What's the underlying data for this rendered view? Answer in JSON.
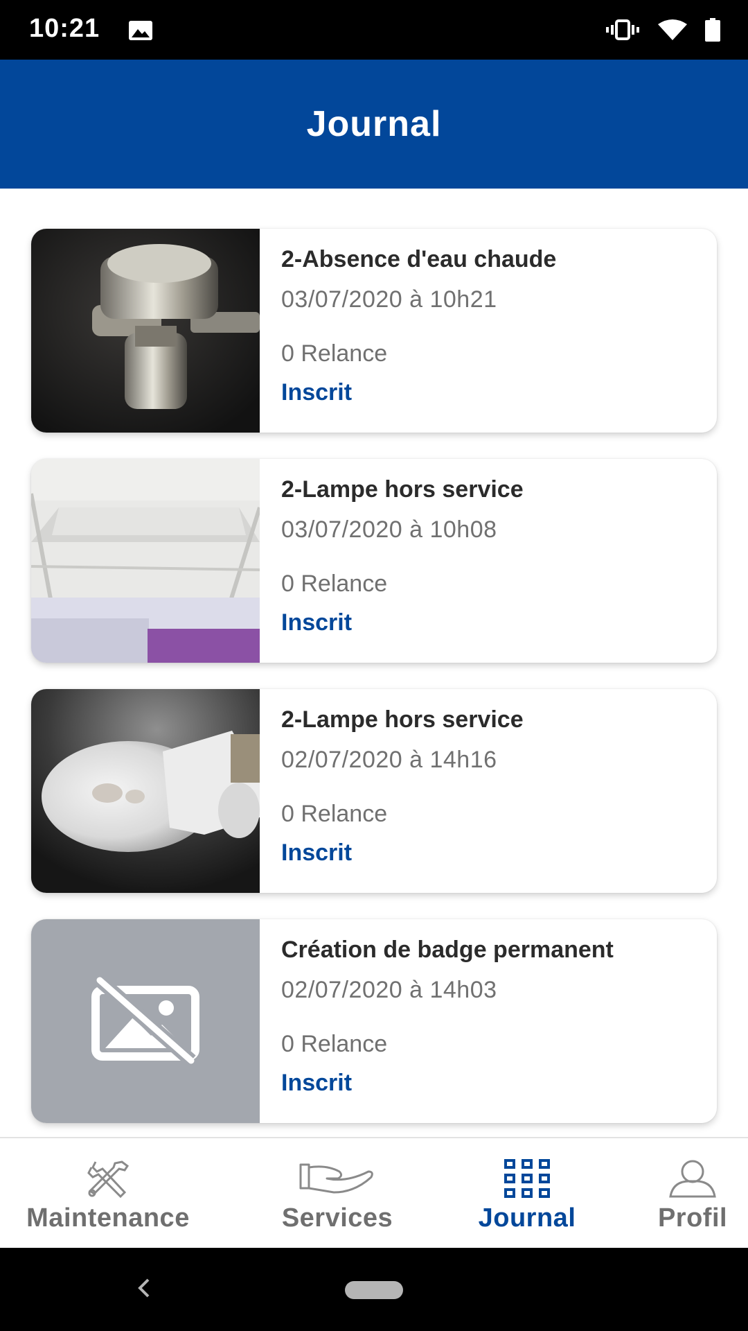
{
  "status_bar": {
    "time": "10:21",
    "icons": [
      "image-icon",
      "vibrate-icon",
      "wifi-icon",
      "battery-icon"
    ]
  },
  "header": {
    "title": "Journal",
    "background": "#02479a"
  },
  "cards": [
    {
      "title": "2-Absence d'eau chaude",
      "date": "03/07/2020 à 10h21",
      "relance": "0 Relance",
      "status": "Inscrit",
      "image": "faucet-photo"
    },
    {
      "title": "2-Lampe hors service",
      "date": "03/07/2020 à 10h08",
      "relance": "0 Relance",
      "status": "Inscrit",
      "image": "ceiling-photo"
    },
    {
      "title": "2-Lampe hors service",
      "date": "02/07/2020 à 14h16",
      "relance": "0 Relance",
      "status": "Inscrit",
      "image": "bulb-photo"
    },
    {
      "title": "Création de badge permanent",
      "date": "02/07/2020 à 14h03",
      "relance": "0 Relance",
      "status": "Inscrit",
      "image": "no-image-icon"
    }
  ],
  "bottom_nav": {
    "items": [
      {
        "label": "Maintenance",
        "icon": "tools-icon",
        "active": false
      },
      {
        "label": "Services",
        "icon": "hand-icon",
        "active": false
      },
      {
        "label": "Journal",
        "icon": "grid-icon",
        "active": true
      },
      {
        "label": "Profil",
        "icon": "person-icon",
        "active": false
      }
    ]
  },
  "colors": {
    "accent": "#02479a",
    "muted_text": "#707070",
    "placeholder_bg": "#a3a7ae"
  }
}
